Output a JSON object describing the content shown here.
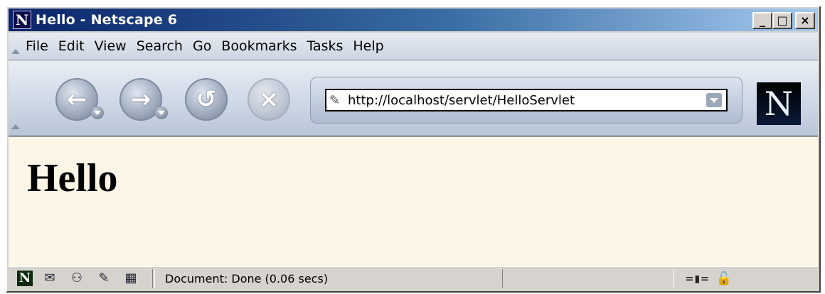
{
  "window": {
    "title": "Hello - Netscape 6",
    "app_icon": "N",
    "controls": [
      "_",
      "□",
      "×"
    ]
  },
  "menu": {
    "items": [
      "File",
      "Edit",
      "View",
      "Search",
      "Go",
      "Bookmarks",
      "Tasks",
      "Help"
    ]
  },
  "toolbar": {
    "back_icon": "back-icon",
    "forward_icon": "forward-icon",
    "reload_icon": "reload-icon",
    "stop_icon": "stop-icon",
    "url": "http://localhost/servlet/HelloServlet",
    "throbber_letter": "N"
  },
  "content": {
    "heading": "Hello"
  },
  "status": {
    "text": "Document: Done (0.06 secs)",
    "n_icon": "N"
  }
}
